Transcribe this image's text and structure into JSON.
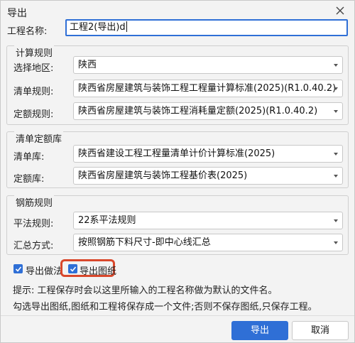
{
  "dialog": {
    "title": "导出",
    "project_name_label": "工程名称:",
    "project_name_value": "工程2(导出)d"
  },
  "calc_rules": {
    "title": "计算规则",
    "region_label": "选择地区:",
    "region_value": "陕西",
    "bill_rule_label": "清单规则:",
    "bill_rule_value": "陕西省房屋建筑与装饰工程工程量计算标准(2025)(R1.0.40.2)",
    "quota_rule_label": "定额规则:",
    "quota_rule_value": "陕西省房屋建筑与装饰工程消耗量定额(2025)(R1.0.40.2)"
  },
  "bill_quota_library": {
    "title": "清单定额库",
    "bill_library_label": "清单库:",
    "bill_library_value": "陕西省建设工程工程量清单计价计算标准(2025)",
    "quota_library_label": "定额库:",
    "quota_library_value": "陕西省房屋建筑与装饰工程基价表(2025)"
  },
  "rebar_rules": {
    "title": "钢筋规则",
    "flat_rule_label": "平法规则:",
    "flat_rule_value": "22系平法规则",
    "summary_label": "汇总方式:",
    "summary_value": "按照钢筋下料尺寸-即中心线汇总"
  },
  "options": {
    "export_practice_label": "导出做法",
    "export_practice_checked": true,
    "export_drawings_label": "导出图纸",
    "export_drawings_checked": true
  },
  "hints": {
    "line1": "提示: 工程保存时会以这里所输入的工程名称做为默认的文件名。",
    "line2": "勾选导出图纸,图纸和工程将保存成一个文件;否则不保存图纸,只保存工程。"
  },
  "buttons": {
    "ok_label": "导出",
    "cancel_label": "取消"
  },
  "colors": {
    "accent": "#2f6fd6",
    "highlight": "#d9482c"
  }
}
